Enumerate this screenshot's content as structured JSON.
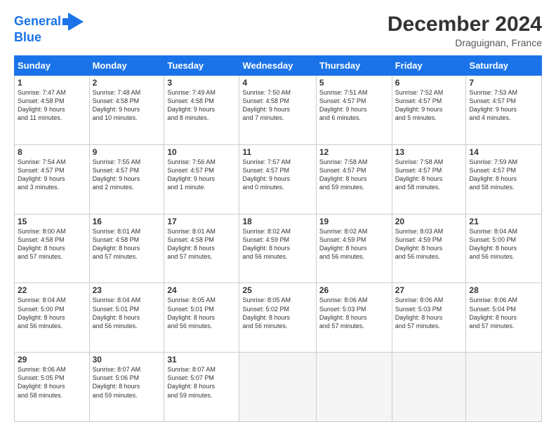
{
  "logo": {
    "line1": "General",
    "line2": "Blue"
  },
  "title": "December 2024",
  "subtitle": "Draguignan, France",
  "headers": [
    "Sunday",
    "Monday",
    "Tuesday",
    "Wednesday",
    "Thursday",
    "Friday",
    "Saturday"
  ],
  "weeks": [
    [
      {
        "day": "1",
        "info": "Sunrise: 7:47 AM\nSunset: 4:58 PM\nDaylight: 9 hours\nand 11 minutes."
      },
      {
        "day": "2",
        "info": "Sunrise: 7:48 AM\nSunset: 4:58 PM\nDaylight: 9 hours\nand 10 minutes."
      },
      {
        "day": "3",
        "info": "Sunrise: 7:49 AM\nSunset: 4:58 PM\nDaylight: 9 hours\nand 8 minutes."
      },
      {
        "day": "4",
        "info": "Sunrise: 7:50 AM\nSunset: 4:58 PM\nDaylight: 9 hours\nand 7 minutes."
      },
      {
        "day": "5",
        "info": "Sunrise: 7:51 AM\nSunset: 4:57 PM\nDaylight: 9 hours\nand 6 minutes."
      },
      {
        "day": "6",
        "info": "Sunrise: 7:52 AM\nSunset: 4:57 PM\nDaylight: 9 hours\nand 5 minutes."
      },
      {
        "day": "7",
        "info": "Sunrise: 7:53 AM\nSunset: 4:57 PM\nDaylight: 9 hours\nand 4 minutes."
      }
    ],
    [
      {
        "day": "8",
        "info": "Sunrise: 7:54 AM\nSunset: 4:57 PM\nDaylight: 9 hours\nand 3 minutes."
      },
      {
        "day": "9",
        "info": "Sunrise: 7:55 AM\nSunset: 4:57 PM\nDaylight: 9 hours\nand 2 minutes."
      },
      {
        "day": "10",
        "info": "Sunrise: 7:56 AM\nSunset: 4:57 PM\nDaylight: 9 hours\nand 1 minute."
      },
      {
        "day": "11",
        "info": "Sunrise: 7:57 AM\nSunset: 4:57 PM\nDaylight: 9 hours\nand 0 minutes."
      },
      {
        "day": "12",
        "info": "Sunrise: 7:58 AM\nSunset: 4:57 PM\nDaylight: 8 hours\nand 59 minutes."
      },
      {
        "day": "13",
        "info": "Sunrise: 7:58 AM\nSunset: 4:57 PM\nDaylight: 8 hours\nand 58 minutes."
      },
      {
        "day": "14",
        "info": "Sunrise: 7:59 AM\nSunset: 4:57 PM\nDaylight: 8 hours\nand 58 minutes."
      }
    ],
    [
      {
        "day": "15",
        "info": "Sunrise: 8:00 AM\nSunset: 4:58 PM\nDaylight: 8 hours\nand 57 minutes."
      },
      {
        "day": "16",
        "info": "Sunrise: 8:01 AM\nSunset: 4:58 PM\nDaylight: 8 hours\nand 57 minutes."
      },
      {
        "day": "17",
        "info": "Sunrise: 8:01 AM\nSunset: 4:58 PM\nDaylight: 8 hours\nand 57 minutes."
      },
      {
        "day": "18",
        "info": "Sunrise: 8:02 AM\nSunset: 4:59 PM\nDaylight: 8 hours\nand 56 minutes."
      },
      {
        "day": "19",
        "info": "Sunrise: 8:02 AM\nSunset: 4:59 PM\nDaylight: 8 hours\nand 56 minutes."
      },
      {
        "day": "20",
        "info": "Sunrise: 8:03 AM\nSunset: 4:59 PM\nDaylight: 8 hours\nand 56 minutes."
      },
      {
        "day": "21",
        "info": "Sunrise: 8:04 AM\nSunset: 5:00 PM\nDaylight: 8 hours\nand 56 minutes."
      }
    ],
    [
      {
        "day": "22",
        "info": "Sunrise: 8:04 AM\nSunset: 5:00 PM\nDaylight: 8 hours\nand 56 minutes."
      },
      {
        "day": "23",
        "info": "Sunrise: 8:04 AM\nSunset: 5:01 PM\nDaylight: 8 hours\nand 56 minutes."
      },
      {
        "day": "24",
        "info": "Sunrise: 8:05 AM\nSunset: 5:01 PM\nDaylight: 8 hours\nand 56 minutes."
      },
      {
        "day": "25",
        "info": "Sunrise: 8:05 AM\nSunset: 5:02 PM\nDaylight: 8 hours\nand 56 minutes."
      },
      {
        "day": "26",
        "info": "Sunrise: 8:06 AM\nSunset: 5:03 PM\nDaylight: 8 hours\nand 57 minutes."
      },
      {
        "day": "27",
        "info": "Sunrise: 8:06 AM\nSunset: 5:03 PM\nDaylight: 8 hours\nand 57 minutes."
      },
      {
        "day": "28",
        "info": "Sunrise: 8:06 AM\nSunset: 5:04 PM\nDaylight: 8 hours\nand 57 minutes."
      }
    ],
    [
      {
        "day": "29",
        "info": "Sunrise: 8:06 AM\nSunset: 5:05 PM\nDaylight: 8 hours\nand 58 minutes."
      },
      {
        "day": "30",
        "info": "Sunrise: 8:07 AM\nSunset: 5:06 PM\nDaylight: 8 hours\nand 59 minutes."
      },
      {
        "day": "31",
        "info": "Sunrise: 8:07 AM\nSunset: 5:07 PM\nDaylight: 8 hours\nand 59 minutes."
      },
      null,
      null,
      null,
      null
    ]
  ]
}
